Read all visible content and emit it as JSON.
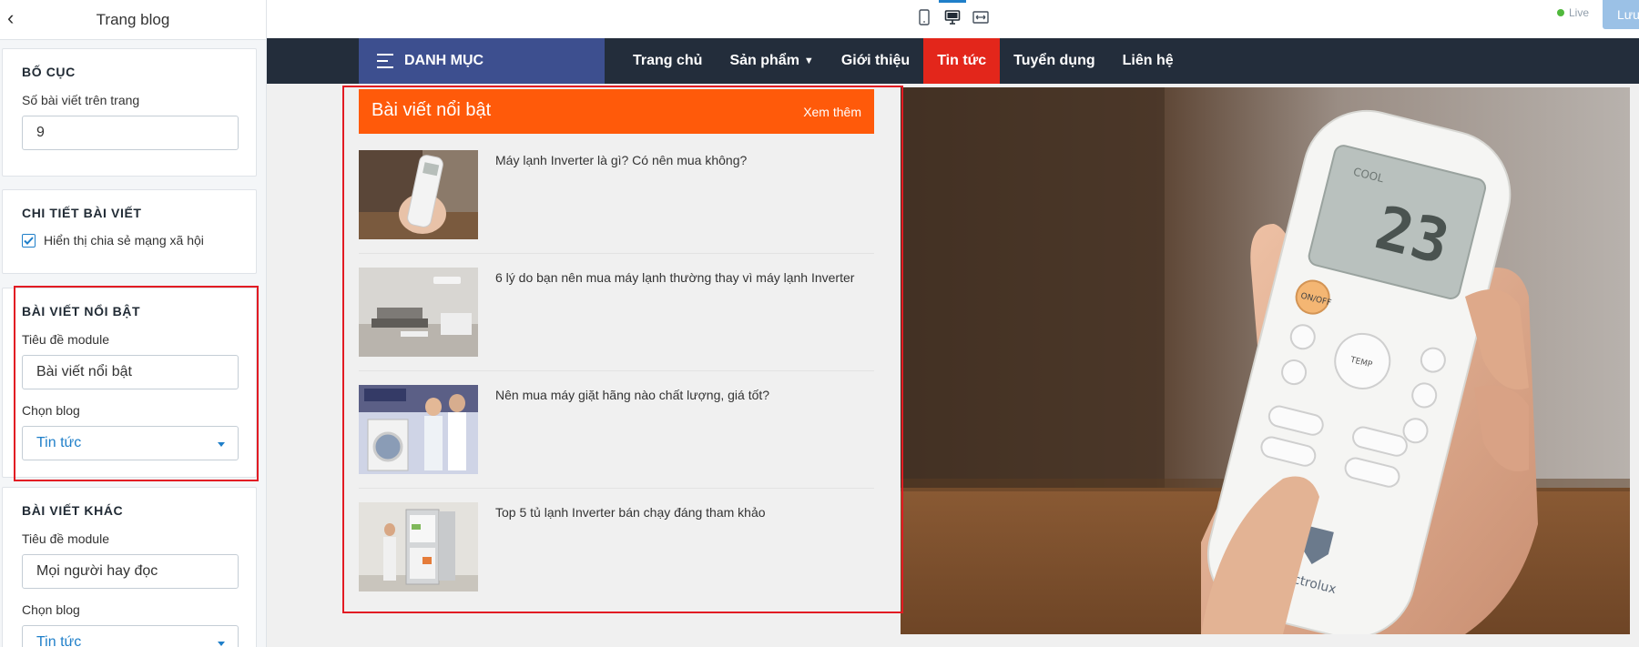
{
  "sidebar": {
    "title": "Trang blog",
    "layout_card": {
      "heading": "BỐ CỤC",
      "posts_per_page_label": "Số bài viết trên trang",
      "posts_per_page_value": "9"
    },
    "post_detail_card": {
      "heading": "CHI TIẾT BÀI VIẾT",
      "share_checkbox_label": "Hiển thị chia sẻ mạng xã hội",
      "share_checked": true
    },
    "featured_card": {
      "heading": "BÀI VIẾT NỔI BẬT",
      "module_title_label": "Tiêu đề module",
      "module_title_value": "Bài viết nổi bật",
      "blog_select_label": "Chọn blog",
      "blog_select_value": "Tin tức"
    },
    "other_card": {
      "heading": "BÀI VIẾT KHÁC",
      "module_title_label": "Tiêu đề module",
      "module_title_value": "Mọi người hay đọc",
      "blog_select_label": "Chọn blog",
      "blog_select_value": "Tin tức"
    }
  },
  "toolbar": {
    "live_label": "Live",
    "save_label": "Lưu"
  },
  "preview": {
    "category_label": "DANH MỤC",
    "menu": [
      {
        "label": "Trang chủ"
      },
      {
        "label": "Sản phẩm"
      },
      {
        "label": "Giới thiệu"
      },
      {
        "label": "Tin tức"
      },
      {
        "label": "Tuyển dụng"
      },
      {
        "label": "Liên hệ"
      }
    ],
    "featured": {
      "title": "Bài viết nổi bật",
      "more_link": "Xem thêm",
      "posts": [
        {
          "title": "Máy lạnh Inverter là gì? Có nên mua không?"
        },
        {
          "title": "6 lý do bạn nên mua máy lạnh thường thay vì máy lạnh Inverter"
        },
        {
          "title": "Nên mua máy giặt hãng nào chất lượng, giá tốt?"
        },
        {
          "title": "Top 5 tủ lạnh Inverter bán chạy đáng tham khảo"
        }
      ]
    },
    "hero": {
      "remote_temp": "23",
      "remote_brand": "Electrolux"
    }
  },
  "colors": {
    "accent": "#1f7fc9",
    "featured_header": "#ff5a0a",
    "nav_bg": "#232d3b",
    "category_bg": "#3d4f8f",
    "active_nav": "#e3261b",
    "highlight_box": "#e21b23"
  }
}
